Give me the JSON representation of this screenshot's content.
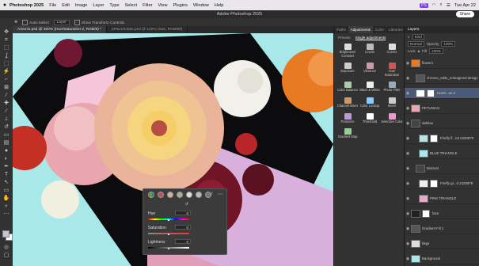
{
  "menubar": {
    "apple_icon": "",
    "app": "Photoshop 2025",
    "items": [
      "File",
      "Edit",
      "Image",
      "Layer",
      "Type",
      "Select",
      "Filter",
      "View",
      "Plugins",
      "Window",
      "Help"
    ],
    "clock": "Tue Apr 22",
    "status_pill": "PS"
  },
  "window": {
    "title": "Adobe Photoshop 2025",
    "share_label": "Share"
  },
  "options_bar": {
    "auto_select_label": "Auto-Select",
    "auto_select_value": "Layer",
    "transform_label": "Show Transform Controls"
  },
  "doc_tabs": [
    "Artemis.psd @ 300% (Hue/Saturation 2, RGB/8) *",
    "aPlaceholder.psd @ 132% (Sub, RGB/8#)"
  ],
  "properties": {
    "hue_label": "Hue",
    "hue_value": "0",
    "saturation_label": "Saturation",
    "saturation_value": "0",
    "lightness_label": "Lightness",
    "lightness_value": "0"
  },
  "adjust_panel": {
    "tabs": [
      "Paths",
      "Adjustments",
      "Color",
      "Libraries",
      "Grids"
    ],
    "subtabs": [
      "Presets",
      "Single adjustments"
    ],
    "items": [
      {
        "label": "Brightness/ Contrast",
        "icon": "brightness-icon"
      },
      {
        "label": "Levels",
        "icon": "levels-icon"
      },
      {
        "label": "Curves",
        "icon": "curves-icon"
      },
      {
        "label": "Exposure",
        "icon": "exposure-icon"
      },
      {
        "label": "Vibrance",
        "icon": "vibrance-icon"
      },
      {
        "label": "Hue/ Saturation",
        "icon": "hue-saturation-icon"
      },
      {
        "label": "Color Balance",
        "icon": "color-balance-icon"
      },
      {
        "label": "Black & White",
        "icon": "black-white-icon"
      },
      {
        "label": "Photo Filter",
        "icon": "photo-filter-icon"
      },
      {
        "label": "Channel Mixer",
        "icon": "channel-mixer-icon"
      },
      {
        "label": "Color Lookup",
        "icon": "color-lookup-icon"
      },
      {
        "label": "Invert",
        "icon": "invert-icon"
      },
      {
        "label": "Posterize",
        "icon": "posterize-icon"
      },
      {
        "label": "Threshold",
        "icon": "threshold-icon"
      },
      {
        "label": "Selective Color",
        "icon": "selective-color-icon"
      },
      {
        "label": "Gradient Map",
        "icon": "gradient-map-icon"
      }
    ]
  },
  "layers_panel": {
    "title": "Layers",
    "kind_label": "Kind",
    "mode": "Normal",
    "opacity_label": "Opacity",
    "opacity_value": "100%",
    "lock_label": "Lock",
    "fill_label": "Fill",
    "fill_value": "100%",
    "layers": [
      "flowers",
      "chrome_edits_reimagined design",
      "HueS...on 2",
      "PETUNIAS",
      "dahlias",
      "Firefly fl...nd 2220970",
      "BLUE TRIANGLE",
      "Biotrust",
      "Firefly gr...d 2220978",
      "PINK TRIANGLE",
      "face",
      "Gradient Fill 1",
      "bkgs",
      "Background"
    ]
  },
  "colors": {
    "accent": "#7b3fe4",
    "selected_layer": "#4b5a78",
    "canvas_bg": "#a9e8e8"
  }
}
